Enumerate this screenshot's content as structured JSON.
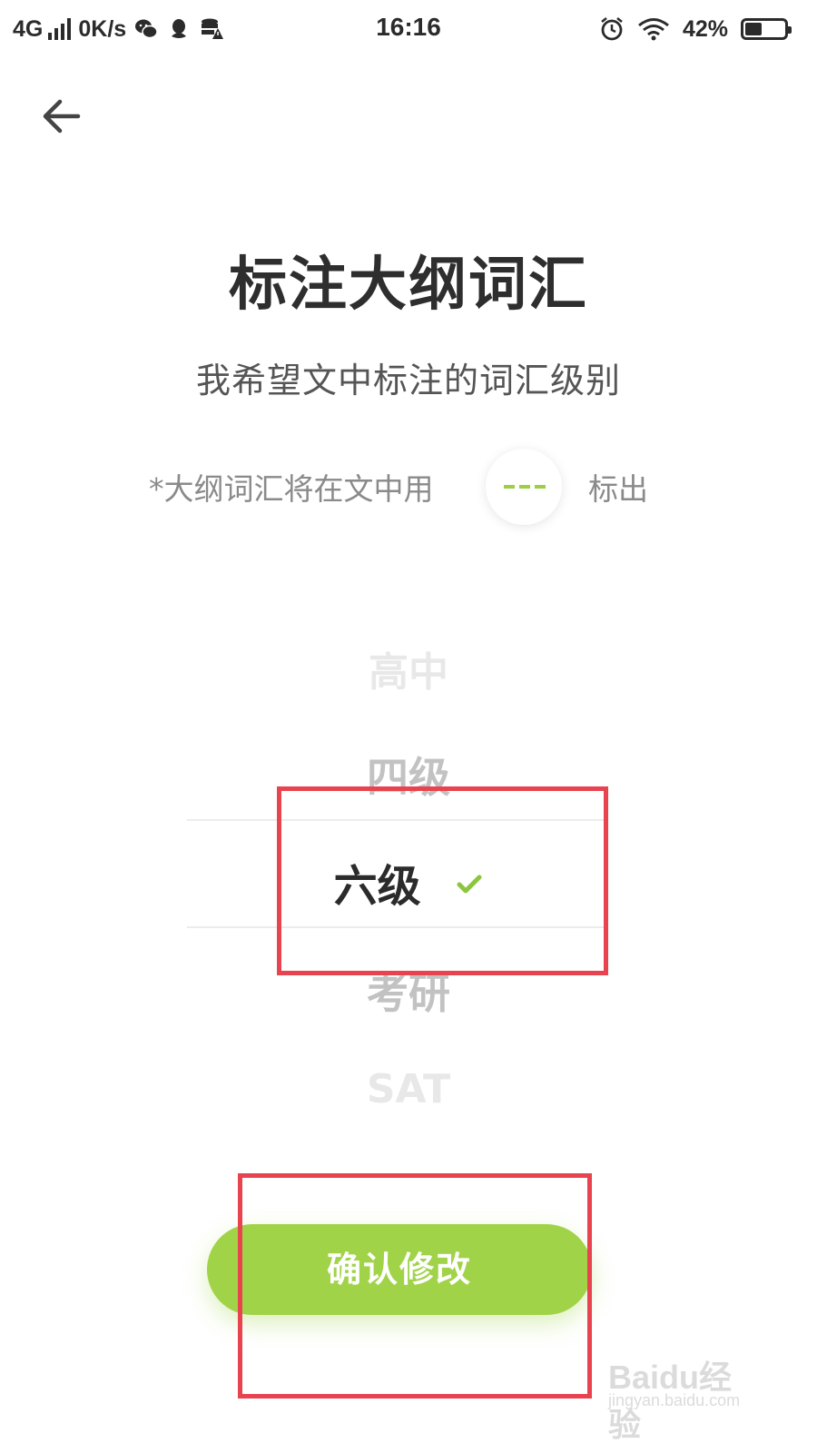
{
  "status_bar": {
    "network": "4G",
    "speed": "0K/s",
    "time": "16:16",
    "battery_percent": "42%",
    "battery_level": 0.42,
    "icons": [
      "signal-icon",
      "wechat-icon",
      "qq-icon",
      "storage-warning-icon",
      "alarm-icon",
      "wifi-icon",
      "battery-icon"
    ]
  },
  "header": {
    "back_icon": "arrow-left-icon"
  },
  "content": {
    "title": "标注大纲词汇",
    "subtitle": "我希望文中标注的词汇级别",
    "hint_prefix": "*大纲词汇将在文中用",
    "hint_suffix": "标出",
    "hint_mark_color": "#9fce44"
  },
  "picker": {
    "options": [
      "高中",
      "四级",
      "六级",
      "考研",
      "SAT"
    ],
    "selected": "六级",
    "check_icon": "check-icon",
    "check_color": "#8cc63f"
  },
  "confirm_button": {
    "label": "确认修改",
    "color": "#a1d349"
  },
  "watermark": {
    "logo": "Baidu经验",
    "url": "jingyan.baidu.com"
  },
  "annotation_color": "#e8444f"
}
